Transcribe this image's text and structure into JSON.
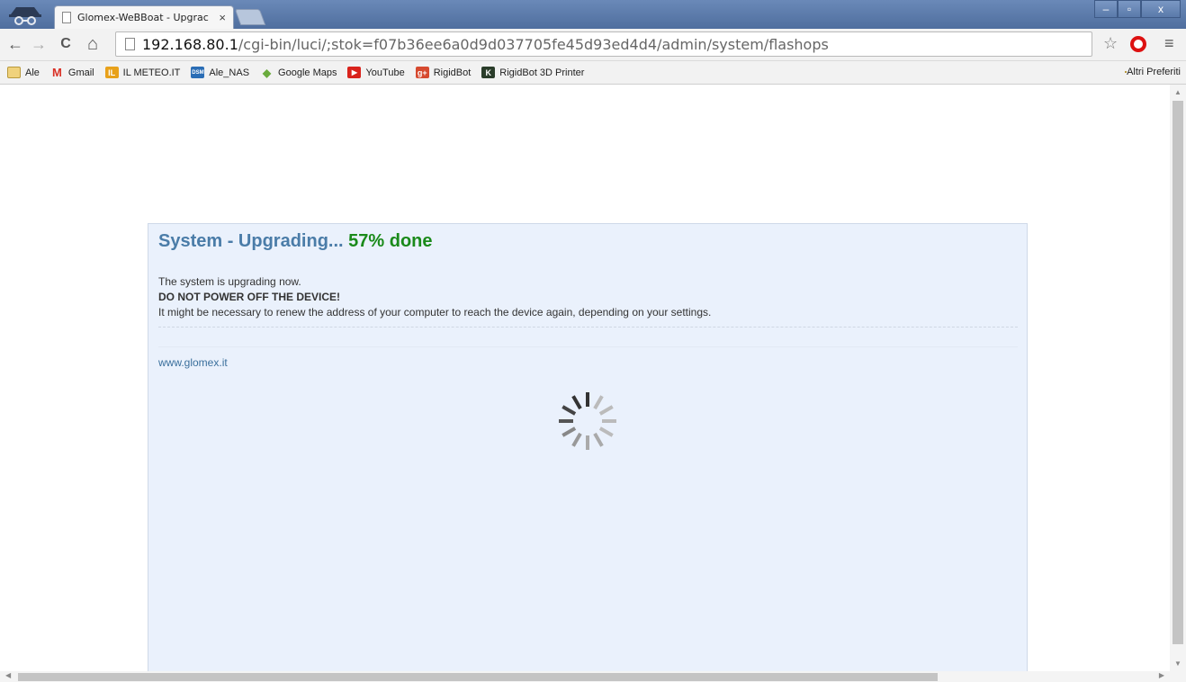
{
  "browser": {
    "tab_title": "Glomex-WeBBoat - Upgrac",
    "tab_close": "×",
    "url_host": "192.168.80.1",
    "url_path": "/cgi-bin/luci/;stok=f07b36ee6a0d9d037705fe45d93ed4d4/admin/system/flashops",
    "icons": {
      "back": "←",
      "forward": "→",
      "reload": "C",
      "home": "⌂",
      "star": "☆",
      "menu": "≡"
    },
    "window_controls": {
      "minimize": "–",
      "maximize": "▫",
      "close": "x"
    }
  },
  "bookmarks": {
    "items": [
      {
        "label": "Ale",
        "icon": "folder-icon"
      },
      {
        "label": "Gmail",
        "icon": "gmail-icon",
        "glyph": "M",
        "color": "#d93025"
      },
      {
        "label": "IL METEO.IT",
        "icon": "meteo-icon",
        "glyph": "IL",
        "color": "#e8a11a"
      },
      {
        "label": "Ale_NAS",
        "icon": "dsm-icon",
        "glyph": "DSM",
        "color": "#2a6db5"
      },
      {
        "label": "Google Maps",
        "icon": "maps-icon",
        "glyph": "◆",
        "color": "#6aab3d"
      },
      {
        "label": "YouTube",
        "icon": "youtube-icon",
        "glyph": "▶",
        "color": "#d9231c"
      },
      {
        "label": "RigidBot",
        "icon": "gplus-icon",
        "glyph": "g+",
        "color": "#d6492f"
      },
      {
        "label": "RigidBot 3D Printer",
        "icon": "kickstarter-icon",
        "glyph": "K",
        "color": "#2a3d2a"
      }
    ],
    "other_folder": "Altri Preferiti"
  },
  "page": {
    "heading_prefix": "System - Upgrading... ",
    "heading_progress": "57% done",
    "progress_percent": 57,
    "line1": "The system is upgrading now.",
    "line2": "DO NOT POWER OFF THE DEVICE!",
    "line3": "It might be necessary to renew the address of your computer to reach the device again, depending on your settings.",
    "footer_link": "www.glomex.it"
  }
}
